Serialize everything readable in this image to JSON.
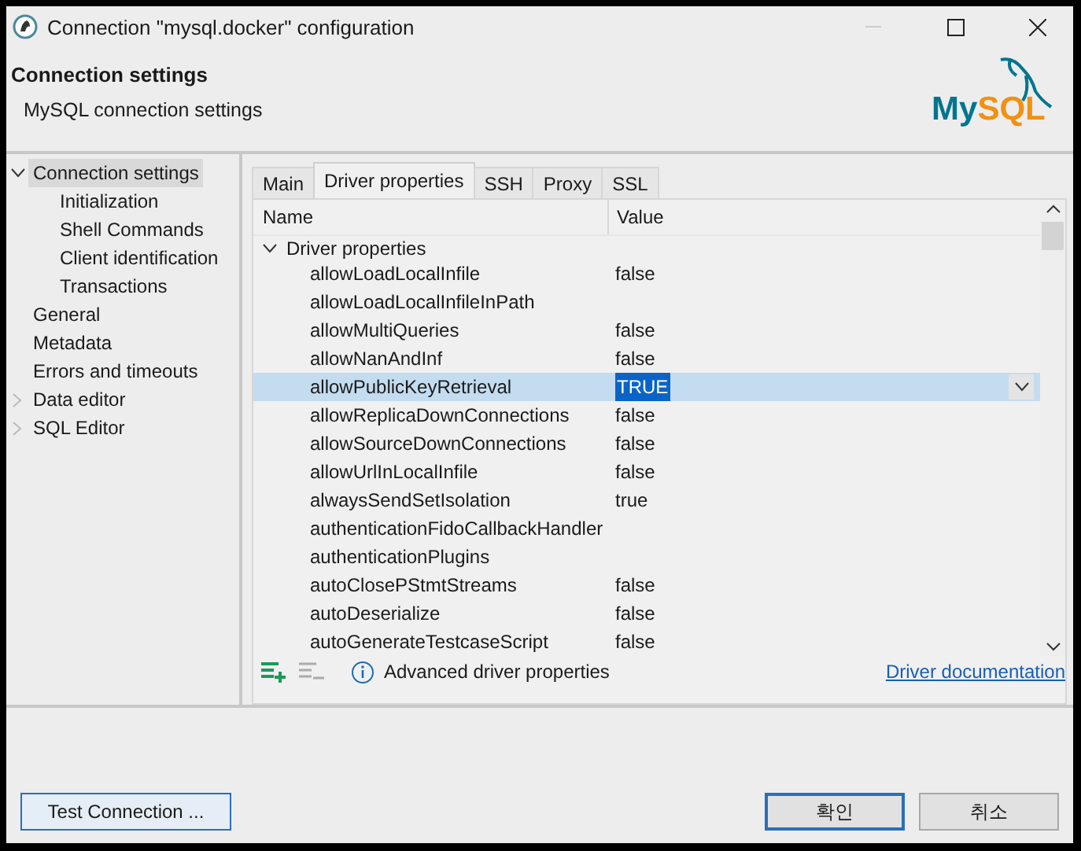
{
  "window": {
    "title": "Connection \"mysql.docker\" configuration"
  },
  "header": {
    "title": "Connection settings",
    "subtitle": "MySQL connection settings",
    "logo": {
      "part_1": "My",
      "part_2": "SQL"
    }
  },
  "sidebar": {
    "items": [
      {
        "label": "Connection settings",
        "selected": true,
        "expanded": true,
        "children": [
          {
            "label": "Initialization",
            "selected": false
          },
          {
            "label": "Shell Commands",
            "selected": false
          },
          {
            "label": "Client identification",
            "selected": false
          },
          {
            "label": "Transactions",
            "selected": false
          }
        ]
      },
      {
        "label": "General",
        "selected": false
      },
      {
        "label": "Metadata",
        "selected": false
      },
      {
        "label": "Errors and timeouts",
        "selected": false
      },
      {
        "label": "Data editor",
        "selected": false,
        "expanded": false
      },
      {
        "label": "SQL Editor",
        "selected": false,
        "expanded": false
      }
    ]
  },
  "tabs": [
    {
      "label": "Main",
      "selected": false
    },
    {
      "label": "Driver properties",
      "selected": true
    },
    {
      "label": "SSH",
      "selected": false
    },
    {
      "label": "Proxy",
      "selected": false
    },
    {
      "label": "SSL",
      "selected": false
    }
  ],
  "table": {
    "columns": [
      "Name",
      "Value"
    ],
    "groups": [
      {
        "label": "Driver properties",
        "expanded": true,
        "rows": [
          {
            "name": "allowLoadLocalInfile",
            "value": "false",
            "selected": false
          },
          {
            "name": "allowLoadLocalInfileInPath",
            "selected": false
          },
          {
            "name": "allowMultiQueries",
            "value": "false",
            "selected": false
          },
          {
            "name": "allowNanAndInf",
            "value": "false",
            "selected": false
          },
          {
            "name": "allowPublicKeyRetrieval",
            "value": "TRUE",
            "selected": true
          },
          {
            "name": "allowReplicaDownConnections",
            "value": "false",
            "selected": false
          },
          {
            "name": "allowSourceDownConnections",
            "value": "false",
            "selected": false
          },
          {
            "name": "allowUrlInLocalInfile",
            "value": "false",
            "selected": false
          },
          {
            "name": "alwaysSendSetIsolation",
            "value": "true",
            "selected": false
          },
          {
            "name": "authenticationFidoCallbackHandler",
            "selected": false
          },
          {
            "name": "authenticationPlugins",
            "selected": false
          },
          {
            "name": "autoClosePStmtStreams",
            "value": "false",
            "selected": false
          },
          {
            "name": "autoDeserialize",
            "value": "false",
            "selected": false
          },
          {
            "name": "autoGenerateTestcaseScript",
            "value": "false",
            "selected": false
          }
        ]
      }
    ]
  },
  "toolbar": {
    "info": "Advanced driver properties",
    "link": "Driver documentation"
  },
  "footer": {
    "test_button": "Test Connection ...",
    "buttons": [
      {
        "label": "확인",
        "default": true
      },
      {
        "label": "취소",
        "default": false
      }
    ]
  }
}
